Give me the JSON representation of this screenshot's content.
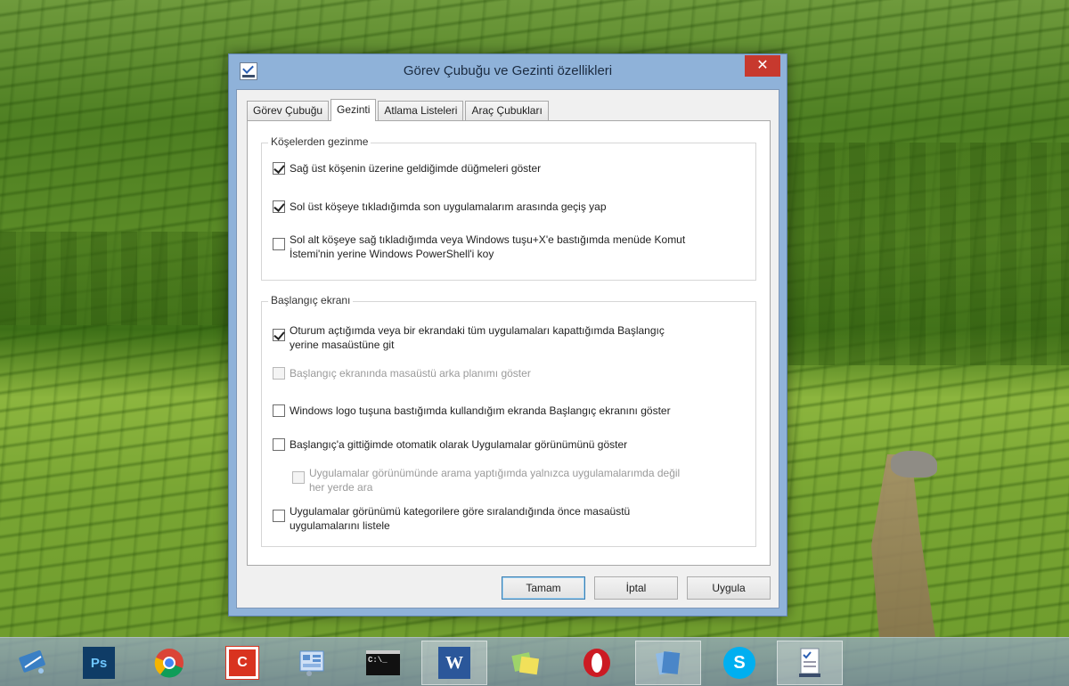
{
  "window": {
    "title": "Görev Çubuğu ve Gezinti özellikleri",
    "close_glyph": "✕"
  },
  "tabs": [
    {
      "label": "Görev Çubuğu",
      "active": false
    },
    {
      "label": "Gezinti",
      "active": true
    },
    {
      "label": "Atlama Listeleri",
      "active": false
    },
    {
      "label": "Araç Çubukları",
      "active": false
    }
  ],
  "corners_group": {
    "title": "Köşelerden gezinme",
    "options": [
      {
        "label": "Sağ üst köşenin üzerine geldiğimde düğmeleri göster",
        "checked": true,
        "disabled": false
      },
      {
        "label": "Sol üst köşeye tıkladığımda son uygulamalarım arasında geçiş yap",
        "checked": true,
        "disabled": false
      },
      {
        "label_line1": "Sol alt köşeye sağ tıkladığımda veya Windows tuşu+X'e bastığımda menüde Komut",
        "label_line2": "İstemi'nin yerine Windows PowerShell'i koy",
        "checked": false,
        "disabled": false
      }
    ]
  },
  "start_group": {
    "title": "Başlangıç ekranı",
    "options": [
      {
        "label_line1": "Oturum açtığımda veya bir ekrandaki tüm uygulamaları kapattığımda Başlangıç",
        "label_line2": "yerine masaüstüne git",
        "checked": true,
        "disabled": false
      },
      {
        "label": "Başlangıç ekranında masaüstü arka planımı göster",
        "checked": false,
        "disabled": true
      },
      {
        "label": "Windows logo tuşuna bastığımda kullandığım ekranda Başlangıç ekranını göster",
        "checked": false,
        "disabled": false
      },
      {
        "label": "Başlangıç'a gittiğimde otomatik olarak Uygulamalar görünümünü göster",
        "checked": false,
        "disabled": false
      },
      {
        "label_line1": "Uygulamalar görünümünde arama yaptığımda yalnızca uygulamalarımda değil",
        "label_line2": "her yerde ara",
        "checked": false,
        "disabled": true
      },
      {
        "label_line1": "Uygulamalar görünümü kategorilere göre sıralandığında önce masaüstü",
        "label_line2": "uygulamalarını listele",
        "checked": false,
        "disabled": false
      }
    ]
  },
  "buttons": {
    "ok": "Tamam",
    "cancel": "İptal",
    "apply": "Uygula"
  },
  "taskbar": {
    "items": [
      {
        "icon": "network-diagram-icon",
        "glyph": "",
        "color": "#3a7fc4"
      },
      {
        "icon": "photoshop-icon",
        "glyph": "Ps",
        "color": "#0f3c66"
      },
      {
        "icon": "chrome-icon",
        "glyph": "",
        "color": "#db4437"
      },
      {
        "icon": "app-c-icon",
        "glyph": "C",
        "color": "#d9331f"
      },
      {
        "icon": "settings-panel-icon",
        "glyph": "",
        "color": "#5a8fcf"
      },
      {
        "icon": "command-prompt-icon",
        "glyph": "C:\\_",
        "color": "#111111"
      },
      {
        "icon": "word-icon",
        "glyph": "W",
        "color": "#2b579a"
      },
      {
        "icon": "sticky-notes-icon",
        "glyph": "",
        "color": "#e8d84a"
      },
      {
        "icon": "opera-icon",
        "glyph": "O",
        "color": "#cc1b23"
      },
      {
        "icon": "documents-icon",
        "glyph": "",
        "color": "#4a86c8"
      },
      {
        "icon": "skype-icon",
        "glyph": "S",
        "color": "#00aff0"
      },
      {
        "icon": "taskbar-properties-icon",
        "glyph": "",
        "color": "#ffffff"
      }
    ]
  }
}
